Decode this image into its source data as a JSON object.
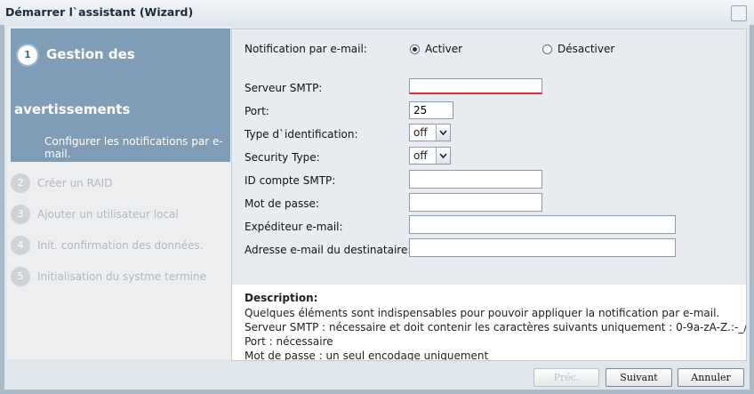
{
  "window": {
    "title": "Démarrer l`assistant (Wizard)"
  },
  "steps": [
    {
      "num": "1",
      "title_line1": "Gestion des",
      "title_line2": "avertissements",
      "desc": "Configurer les notifications par e-mail."
    },
    {
      "num": "2",
      "label": "Créer un RAID"
    },
    {
      "num": "3",
      "label": "Ajouter un utilisateur local"
    },
    {
      "num": "4",
      "label": "Init. confirmation des données."
    },
    {
      "num": "5",
      "label": "Initialisation du systme termine"
    }
  ],
  "form": {
    "notification_label": "Notification par e-mail:",
    "enable_label": "Activer",
    "disable_label": "Désactiver",
    "smtp_server_label": "Serveur SMTP:",
    "smtp_server_value": "",
    "port_label": "Port:",
    "port_value": "25",
    "auth_type_label": "Type d`identification:",
    "auth_type_value": "off",
    "security_type_label": "Security Type:",
    "security_type_value": "off",
    "smtp_account_label": "ID compte SMTP:",
    "smtp_account_value": "",
    "password_label": "Mot de passe:",
    "password_value": "",
    "sender_label": "Expéditeur e-mail:",
    "sender_value": "",
    "recipient_label": "Adresse e-mail du destinataire:",
    "recipient_value": ""
  },
  "description": {
    "title": "Description:",
    "lines": [
      "Quelques éléments sont indispensables pour pouvoir appliquer la notification par e-mail.",
      "Serveur SMTP : nécessaire et doit contenir les caractères suivants uniquement : 0-9a-zA-Z.:-_/",
      "Port : nécessaire",
      "Mot de passe : un seul encodage uniquement"
    ]
  },
  "footer": {
    "prev_label": "Préc.",
    "next_label": "Suivant",
    "cancel_label": "Annuler"
  },
  "colors": {
    "active_step_bg": "#7f9db6",
    "error_underline": "#d7332d"
  }
}
